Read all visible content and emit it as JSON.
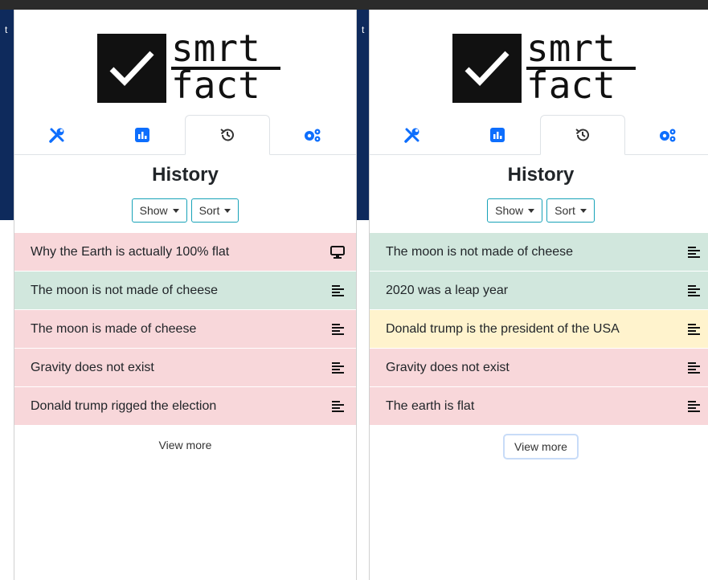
{
  "background": {
    "tab_left": "t",
    "tab_mid": "t"
  },
  "panels": [
    {
      "logo": {
        "line1": "smrt",
        "line2": "fact"
      },
      "tabs": [
        "tools-icon",
        "chart-icon",
        "history-icon",
        "gears-icon"
      ],
      "active_tab": 2,
      "title": "History",
      "show_label": "Show",
      "sort_label": "Sort",
      "items": [
        {
          "text": "Why the Earth is actually 100% flat",
          "status": "red",
          "icon": "monitor-icon"
        },
        {
          "text": "The moon is not made of cheese",
          "status": "green",
          "icon": "text-icon"
        },
        {
          "text": "The moon is made of cheese",
          "status": "red",
          "icon": "text-icon"
        },
        {
          "text": "Gravity does not exist",
          "status": "red",
          "icon": "text-icon"
        },
        {
          "text": "Donald trump rigged the election",
          "status": "red",
          "icon": "text-icon"
        }
      ],
      "view_more": "View more"
    },
    {
      "logo": {
        "line1": "smrt",
        "line2": "fact"
      },
      "tabs": [
        "tools-icon",
        "chart-icon",
        "history-icon",
        "gears-icon"
      ],
      "active_tab": 2,
      "title": "History",
      "show_label": "Show",
      "sort_label": "Sort",
      "items": [
        {
          "text": "The moon is not made of cheese",
          "status": "green",
          "icon": "text-icon"
        },
        {
          "text": "2020 was a leap year",
          "status": "green",
          "icon": "text-icon"
        },
        {
          "text": "Donald trump is the president of the USA",
          "status": "yellow",
          "icon": "text-icon"
        },
        {
          "text": "Gravity does not exist",
          "status": "red",
          "icon": "text-icon"
        },
        {
          "text": "The earth is flat",
          "status": "red",
          "icon": "text-icon"
        }
      ],
      "view_more": "View more"
    }
  ],
  "colors": {
    "red": "#f8d7da",
    "green": "#d1e7dd",
    "yellow": "#fff3cd",
    "accent": "#17a2b8",
    "icon_blue": "#0d6efd"
  }
}
